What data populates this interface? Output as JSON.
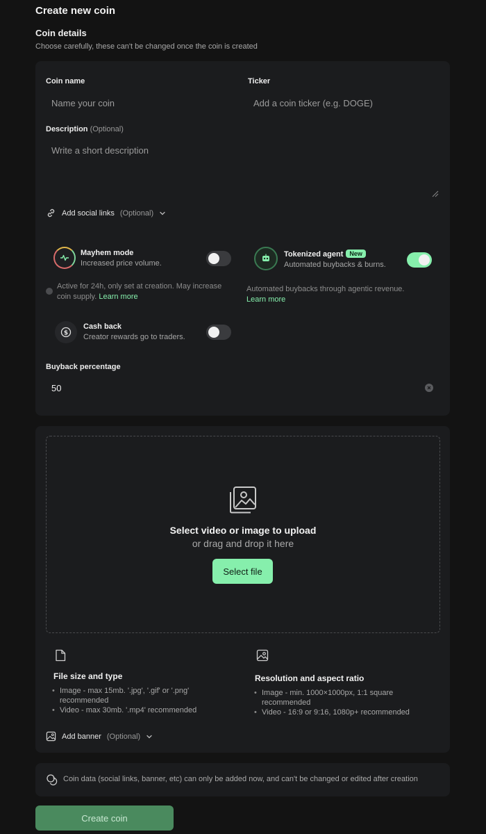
{
  "header": {
    "title": "Create new coin"
  },
  "details": {
    "title": "Coin details",
    "subtitle": "Choose carefully, these can't be changed once the coin is created",
    "coin_name": {
      "label": "Coin name",
      "placeholder": "Name your coin"
    },
    "ticker": {
      "label": "Ticker",
      "placeholder": "Add a coin ticker (e.g. DOGE)"
    },
    "description": {
      "label": "Description",
      "optional": "(Optional)",
      "placeholder": "Write a short description"
    },
    "social_links": {
      "label": "Add social links",
      "optional": "(Optional)"
    },
    "mayhem": {
      "title": "Mayhem mode",
      "subtitle": "Increased price volume.",
      "hint": "Active for 24h, only set at creation. May increase coin supply.",
      "link": "Learn more",
      "enabled": false
    },
    "agent": {
      "title": "Tokenized agent",
      "badge": "New",
      "subtitle": "Automated buybacks & burns.",
      "hint": "Automated buybacks through agentic revenue.",
      "link": "Learn more",
      "enabled": true
    },
    "cashback": {
      "title": "Cash back",
      "subtitle": "Creator rewards go to traders.",
      "enabled": false
    },
    "buyback": {
      "label": "Buyback percentage",
      "value": "50"
    }
  },
  "upload": {
    "title": "Select video or image to upload",
    "subtitle": "or drag and drop it here",
    "button": "Select file",
    "file_info": {
      "title": "File size and type",
      "items": [
        "Image - max 15mb. '.jpg', '.gif' or '.png' recommended",
        "Video - max 30mb. '.mp4' recommended"
      ]
    },
    "resolution_info": {
      "title": "Resolution and aspect ratio",
      "items": [
        "Image - min. 1000×1000px, 1:1 square recommended",
        "Video - 16:9 or 9:16, 1080p+ recommended"
      ]
    },
    "banner": {
      "label": "Add banner",
      "optional": "(Optional)"
    }
  },
  "note": {
    "text": "Coin data (social links, banner, etc) can only be added now, and can't be changed or edited after creation"
  },
  "footer": {
    "create_button": "Create coin"
  },
  "colors": {
    "accent": "#86efac",
    "background": "#131313",
    "card": "#1b1c1e",
    "create_button": "#4a8a5e"
  }
}
